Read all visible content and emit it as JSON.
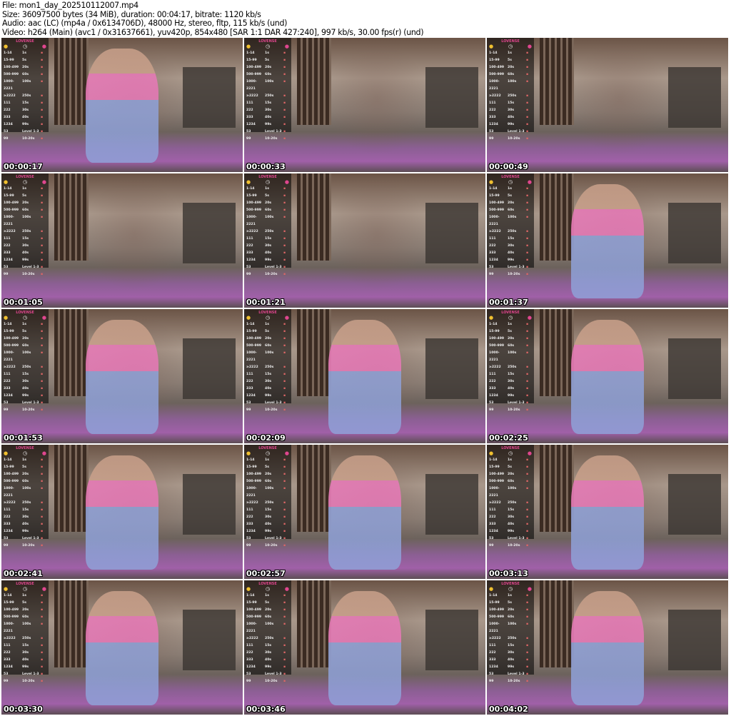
{
  "header": {
    "file": "File: mon1_day_202510112007.mp4",
    "size": "Size: 36097500 bytes (34 MiB), duration: 00:04:17, bitrate: 1120 kb/s",
    "audio": "Audio: aac (LC) (mp4a / 0x6134706D), 48000 Hz, stereo, fltp, 115 kb/s (und)",
    "video": "Video: h264 (Main) (avc1 / 0x31637661), yuv420p, 854x480 [SAR 1:1 DAR 427:240], 997 kb/s, 30.00 fps(r) (und)"
  },
  "overlay": {
    "brand": "LOVENSE",
    "rows": [
      [
        "1-14",
        "1s"
      ],
      [
        "15-99",
        "5s"
      ],
      [
        "100-499",
        "20s"
      ],
      [
        "500-999",
        "60s"
      ],
      [
        "1000-2221",
        "100s"
      ],
      [
        "≥2222",
        "250s"
      ],
      [
        "111",
        "15s"
      ],
      [
        "222",
        "30s"
      ],
      [
        "333",
        "40s"
      ],
      [
        "1234",
        "99s"
      ],
      [
        "53",
        "Level 1-3"
      ],
      [
        "99",
        "10-20s"
      ]
    ]
  },
  "thumbnails": [
    {
      "timestamp": "00:00:17"
    },
    {
      "timestamp": "00:00:33"
    },
    {
      "timestamp": "00:00:49"
    },
    {
      "timestamp": "00:01:05"
    },
    {
      "timestamp": "00:01:21"
    },
    {
      "timestamp": "00:01:37"
    },
    {
      "timestamp": "00:01:53"
    },
    {
      "timestamp": "00:02:09"
    },
    {
      "timestamp": "00:02:25"
    },
    {
      "timestamp": "00:02:41"
    },
    {
      "timestamp": "00:02:57"
    },
    {
      "timestamp": "00:03:13"
    },
    {
      "timestamp": "00:03:30"
    },
    {
      "timestamp": "00:03:46"
    },
    {
      "timestamp": "00:04:02"
    }
  ]
}
